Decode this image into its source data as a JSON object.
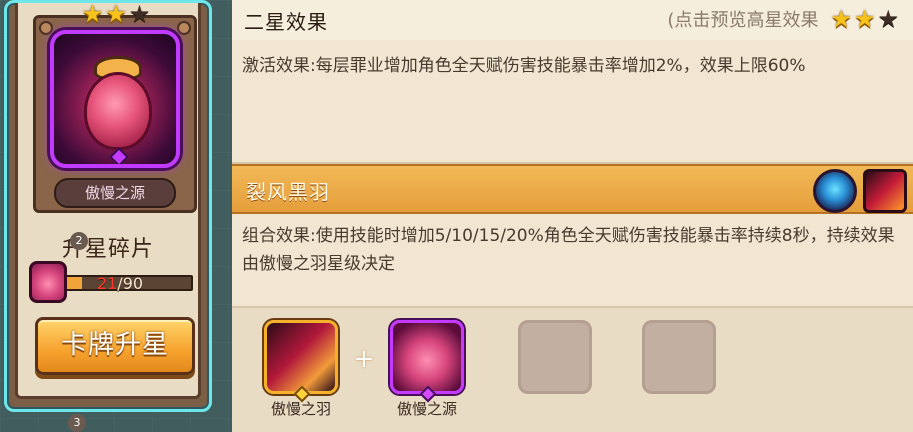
{
  "card": {
    "stars_filled": 2,
    "stars_total": 3,
    "name": "傲慢之源",
    "shard_title": "升星碎片",
    "shard_current": "21",
    "shard_sep": "/",
    "shard_total": "90",
    "shard_progress": 0.2333,
    "upgrade_button": "卡牌升星"
  },
  "header": {
    "title": "二星效果",
    "preview_hint": "(点击预览高星效果",
    "stars_filled": 2,
    "stars_total": 3
  },
  "effect": {
    "text": "激活效果:每层罪业增加角色全天赋伤害技能暴击率增加2%，效果上限60%"
  },
  "combo": {
    "title": "裂风黑羽",
    "text": "组合效果:使用技能时增加5/10/15/20%角色全天赋伤害技能暴击率持续8秒，持续效果由傲慢之羽星级决定",
    "icons": [
      "eye-relic-icon",
      "black-feather-icon"
    ]
  },
  "slots": [
    {
      "label": "傲慢之羽",
      "filled": true,
      "icon": "black-feather-icon"
    },
    {
      "label": "傲慢之源",
      "filled": true,
      "icon": "pride-heart-icon"
    },
    {
      "label": "",
      "filled": false
    },
    {
      "label": "",
      "filled": false
    }
  ],
  "plus_sign": "+",
  "badges": [
    "2",
    "3"
  ],
  "colors": {
    "accent_gold": "#f8c21c",
    "button_orange": "#f6a22e",
    "combo_bar": "#e59e3b",
    "purple_frame": "#c03bff",
    "card_border": "#6fe6ea"
  }
}
